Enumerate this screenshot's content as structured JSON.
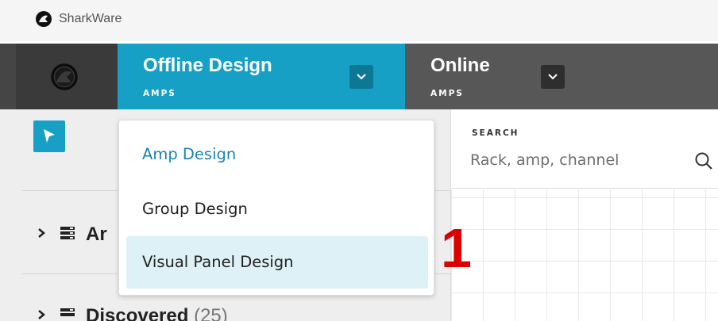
{
  "app": {
    "name": "SharkWare",
    "logo_icon": "sharkware-logo-icon"
  },
  "navbar": {
    "tabs": [
      {
        "title": "Offline Design",
        "subtitle": "AMPS",
        "active": true,
        "chevron_icon": "chevron-down-icon"
      },
      {
        "title": "Online",
        "subtitle": "AMPS",
        "active": false,
        "chevron_icon": "chevron-down-icon"
      }
    ]
  },
  "toolbar": {
    "select_tool_icon": "cursor-arrow-icon"
  },
  "sidebar": {
    "rows": [
      {
        "label": "Ar",
        "count": ""
      },
      {
        "label": "Discovered",
        "count": "(25)"
      }
    ]
  },
  "search": {
    "label": "SEARCH",
    "placeholder": "Rack, amp, channel"
  },
  "dropdown": {
    "items": [
      {
        "label": "Amp Design",
        "state": "current"
      },
      {
        "label": "Group Design",
        "state": "normal"
      },
      {
        "label": "Visual Panel Design",
        "state": "hovered"
      }
    ]
  },
  "annotation": {
    "step_number": "1"
  },
  "colors": {
    "accent": "#16a0c6",
    "navbar": "#454545",
    "sidebar": "#eeeeee",
    "marker": "#dd0000"
  }
}
